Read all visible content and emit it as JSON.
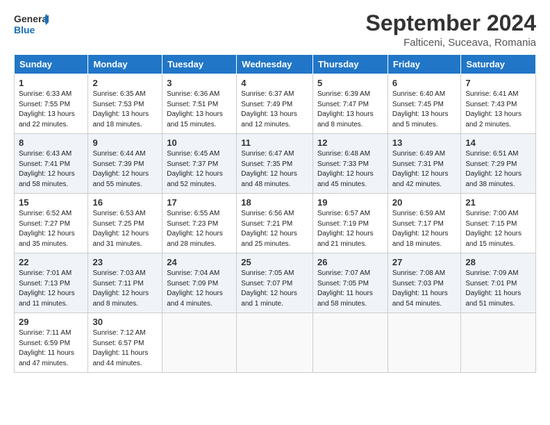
{
  "header": {
    "logo_line1": "General",
    "logo_line2": "Blue",
    "month_year": "September 2024",
    "location": "Falticeni, Suceava, Romania"
  },
  "days_of_week": [
    "Sunday",
    "Monday",
    "Tuesday",
    "Wednesday",
    "Thursday",
    "Friday",
    "Saturday"
  ],
  "weeks": [
    [
      {
        "day": "1",
        "info": "Sunrise: 6:33 AM\nSunset: 7:55 PM\nDaylight: 13 hours\nand 22 minutes."
      },
      {
        "day": "2",
        "info": "Sunrise: 6:35 AM\nSunset: 7:53 PM\nDaylight: 13 hours\nand 18 minutes."
      },
      {
        "day": "3",
        "info": "Sunrise: 6:36 AM\nSunset: 7:51 PM\nDaylight: 13 hours\nand 15 minutes."
      },
      {
        "day": "4",
        "info": "Sunrise: 6:37 AM\nSunset: 7:49 PM\nDaylight: 13 hours\nand 12 minutes."
      },
      {
        "day": "5",
        "info": "Sunrise: 6:39 AM\nSunset: 7:47 PM\nDaylight: 13 hours\nand 8 minutes."
      },
      {
        "day": "6",
        "info": "Sunrise: 6:40 AM\nSunset: 7:45 PM\nDaylight: 13 hours\nand 5 minutes."
      },
      {
        "day": "7",
        "info": "Sunrise: 6:41 AM\nSunset: 7:43 PM\nDaylight: 13 hours\nand 2 minutes."
      }
    ],
    [
      {
        "day": "8",
        "info": "Sunrise: 6:43 AM\nSunset: 7:41 PM\nDaylight: 12 hours\nand 58 minutes."
      },
      {
        "day": "9",
        "info": "Sunrise: 6:44 AM\nSunset: 7:39 PM\nDaylight: 12 hours\nand 55 minutes."
      },
      {
        "day": "10",
        "info": "Sunrise: 6:45 AM\nSunset: 7:37 PM\nDaylight: 12 hours\nand 52 minutes."
      },
      {
        "day": "11",
        "info": "Sunrise: 6:47 AM\nSunset: 7:35 PM\nDaylight: 12 hours\nand 48 minutes."
      },
      {
        "day": "12",
        "info": "Sunrise: 6:48 AM\nSunset: 7:33 PM\nDaylight: 12 hours\nand 45 minutes."
      },
      {
        "day": "13",
        "info": "Sunrise: 6:49 AM\nSunset: 7:31 PM\nDaylight: 12 hours\nand 42 minutes."
      },
      {
        "day": "14",
        "info": "Sunrise: 6:51 AM\nSunset: 7:29 PM\nDaylight: 12 hours\nand 38 minutes."
      }
    ],
    [
      {
        "day": "15",
        "info": "Sunrise: 6:52 AM\nSunset: 7:27 PM\nDaylight: 12 hours\nand 35 minutes."
      },
      {
        "day": "16",
        "info": "Sunrise: 6:53 AM\nSunset: 7:25 PM\nDaylight: 12 hours\nand 31 minutes."
      },
      {
        "day": "17",
        "info": "Sunrise: 6:55 AM\nSunset: 7:23 PM\nDaylight: 12 hours\nand 28 minutes."
      },
      {
        "day": "18",
        "info": "Sunrise: 6:56 AM\nSunset: 7:21 PM\nDaylight: 12 hours\nand 25 minutes."
      },
      {
        "day": "19",
        "info": "Sunrise: 6:57 AM\nSunset: 7:19 PM\nDaylight: 12 hours\nand 21 minutes."
      },
      {
        "day": "20",
        "info": "Sunrise: 6:59 AM\nSunset: 7:17 PM\nDaylight: 12 hours\nand 18 minutes."
      },
      {
        "day": "21",
        "info": "Sunrise: 7:00 AM\nSunset: 7:15 PM\nDaylight: 12 hours\nand 15 minutes."
      }
    ],
    [
      {
        "day": "22",
        "info": "Sunrise: 7:01 AM\nSunset: 7:13 PM\nDaylight: 12 hours\nand 11 minutes."
      },
      {
        "day": "23",
        "info": "Sunrise: 7:03 AM\nSunset: 7:11 PM\nDaylight: 12 hours\nand 8 minutes."
      },
      {
        "day": "24",
        "info": "Sunrise: 7:04 AM\nSunset: 7:09 PM\nDaylight: 12 hours\nand 4 minutes."
      },
      {
        "day": "25",
        "info": "Sunrise: 7:05 AM\nSunset: 7:07 PM\nDaylight: 12 hours\nand 1 minute."
      },
      {
        "day": "26",
        "info": "Sunrise: 7:07 AM\nSunset: 7:05 PM\nDaylight: 11 hours\nand 58 minutes."
      },
      {
        "day": "27",
        "info": "Sunrise: 7:08 AM\nSunset: 7:03 PM\nDaylight: 11 hours\nand 54 minutes."
      },
      {
        "day": "28",
        "info": "Sunrise: 7:09 AM\nSunset: 7:01 PM\nDaylight: 11 hours\nand 51 minutes."
      }
    ],
    [
      {
        "day": "29",
        "info": "Sunrise: 7:11 AM\nSunset: 6:59 PM\nDaylight: 11 hours\nand 47 minutes."
      },
      {
        "day": "30",
        "info": "Sunrise: 7:12 AM\nSunset: 6:57 PM\nDaylight: 11 hours\nand 44 minutes."
      },
      {
        "day": "",
        "info": ""
      },
      {
        "day": "",
        "info": ""
      },
      {
        "day": "",
        "info": ""
      },
      {
        "day": "",
        "info": ""
      },
      {
        "day": "",
        "info": ""
      }
    ]
  ]
}
